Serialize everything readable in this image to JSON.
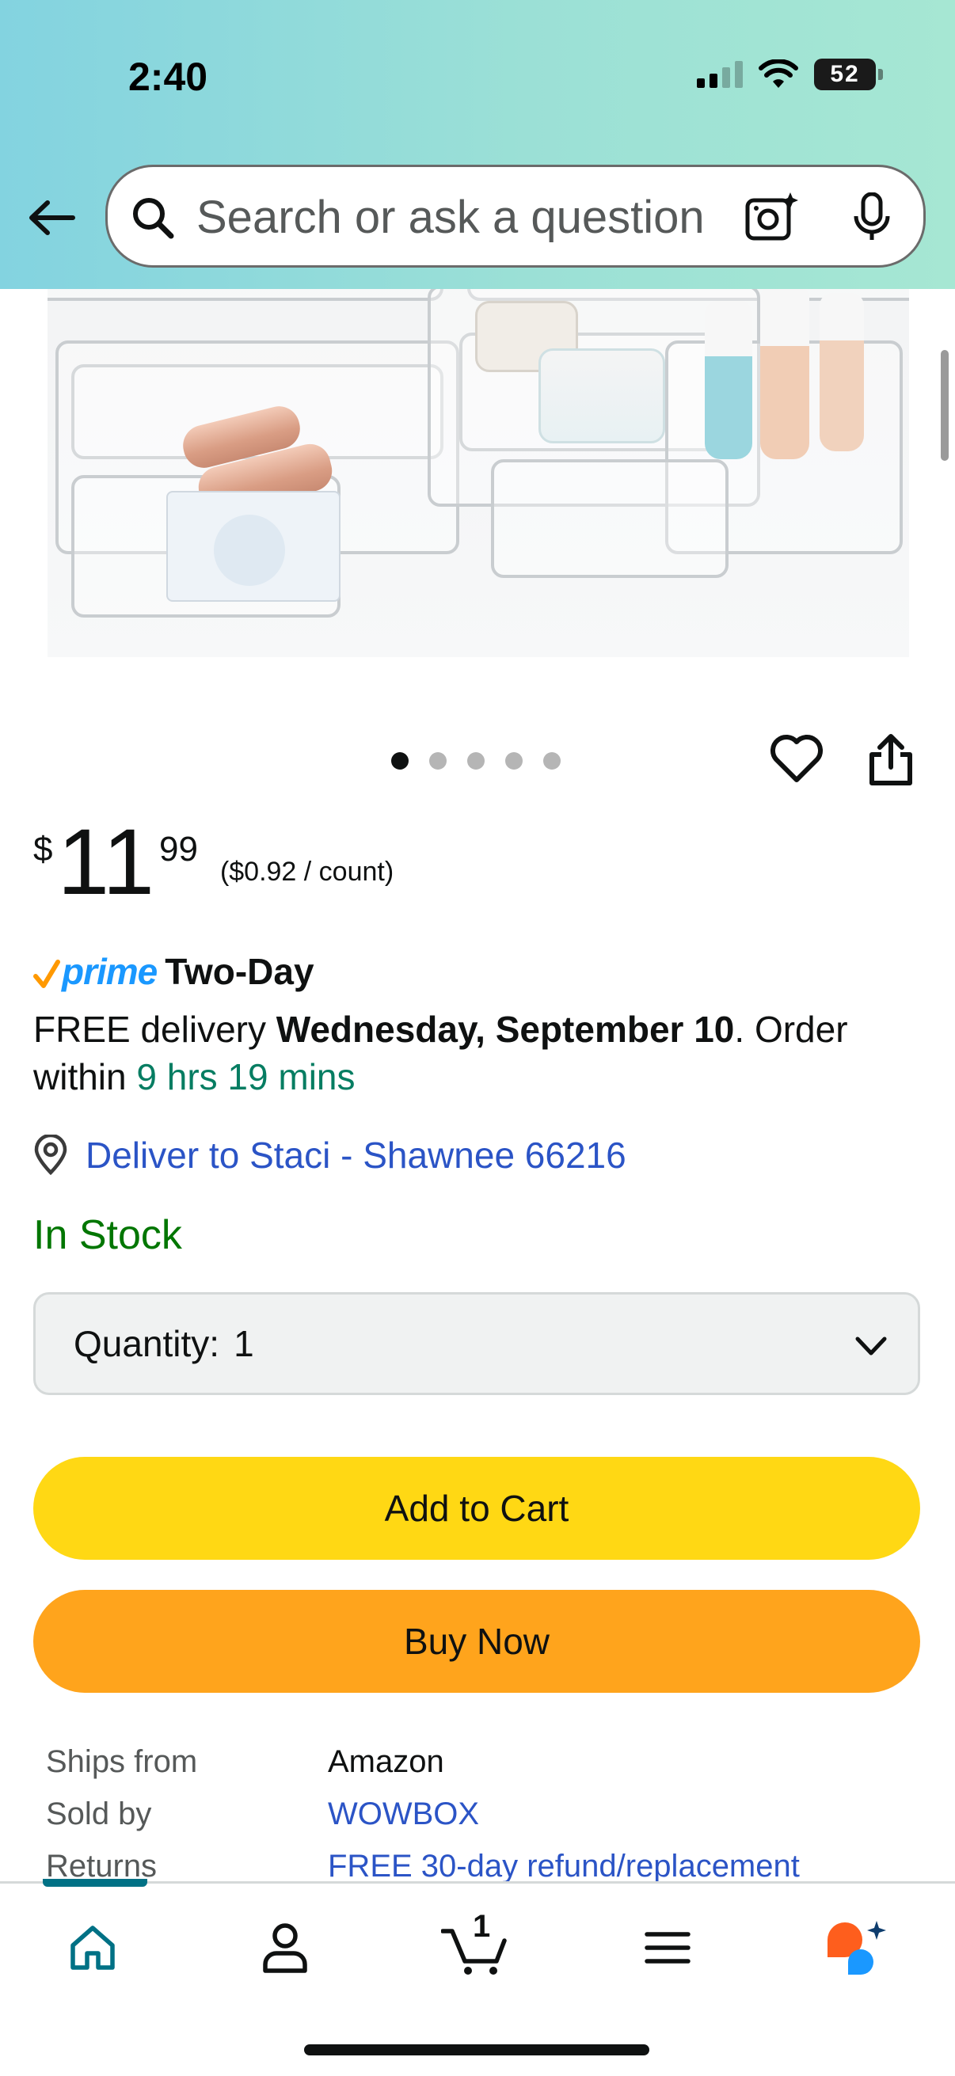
{
  "status_bar": {
    "time": "2:40",
    "battery": "52"
  },
  "search": {
    "placeholder": "Search or ask a question"
  },
  "carousel": {
    "image_count": 5,
    "active_index": 0
  },
  "price": {
    "symbol": "$",
    "whole": "11",
    "fraction": "99",
    "per_unit": "($0.92 / count)"
  },
  "prime": {
    "label": "prime",
    "speed": "Two-Day"
  },
  "delivery": {
    "prefix": "FREE delivery ",
    "date": "Wednesday, September 10",
    "mid": ". Order within ",
    "countdown": "9 hrs 19 mins"
  },
  "deliver_to": "Deliver to Staci - Shawnee 66216",
  "stock_status": "In Stock",
  "quantity": {
    "label": "Quantity:",
    "value": "1"
  },
  "buttons": {
    "add_to_cart": "Add to Cart",
    "buy_now": "Buy Now"
  },
  "details": [
    {
      "key": "Ships from",
      "value": "Amazon"
    },
    {
      "key": "Sold by",
      "value": "WOWBOX"
    },
    {
      "key": "Returns",
      "value": "FREE 30-day refund/replacement"
    }
  ],
  "bottom_nav": {
    "cart_count": "1",
    "active": "home"
  },
  "colors": {
    "add_to_cart": "#ffd814",
    "buy_now": "#ffa41c",
    "prime_blue": "#1a98ff",
    "in_stock_green": "#007600",
    "link_blue": "#2b54c6",
    "countdown_green": "#067d62",
    "nav_active_teal": "#007185"
  }
}
